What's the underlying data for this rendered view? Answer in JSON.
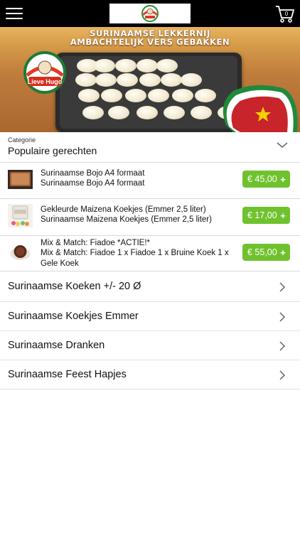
{
  "app": {
    "logo_icon": "lieve-hugo-logo",
    "cart_count": "0",
    "menu_icon": "hamburger-menu-icon",
    "cart_icon": "shopping-cart-icon"
  },
  "hero": {
    "line1": "SURINAAMSE LEKKERNIJ",
    "line2": "AMBACHTELIJK VERS GEBAKKEN",
    "brand_stamp": "Lieve Hugo"
  },
  "category": {
    "small_label": "Categorie",
    "selected": "Populaire gerechten"
  },
  "products": [
    {
      "name": "Surinaamse Bojo A4 formaat",
      "description": "Surinaamse Bojo A4 formaat",
      "price": "€ 45,00",
      "add": "+"
    },
    {
      "name": "Gekleurde Maizena Koekjes (Emmer 2,5 liter)",
      "description": "Surinaamse Maizena Koekjes (Emmer 2,5 liter)",
      "price": "€ 17,00",
      "add": "+"
    },
    {
      "name": "Mix & Match: Fiadoe *ACTIE!*",
      "description": "Mix & Match: Fiadoe 1 x Fiadoe 1 x Bruine Koek 1 x Gele Koek",
      "price": "€ 55,00",
      "add": "+"
    }
  ],
  "categories": [
    {
      "label": "Surinaamse Koeken +/- 20 Ø"
    },
    {
      "label": "Surinaamse Koekjes Emmer"
    },
    {
      "label": "Surinaamse Dranken"
    },
    {
      "label": "Surinaamse Feest Hapjes"
    }
  ],
  "colors": {
    "topbar": "#000000",
    "price_button": "#6fc22d",
    "divider": "#d9d9d9"
  }
}
